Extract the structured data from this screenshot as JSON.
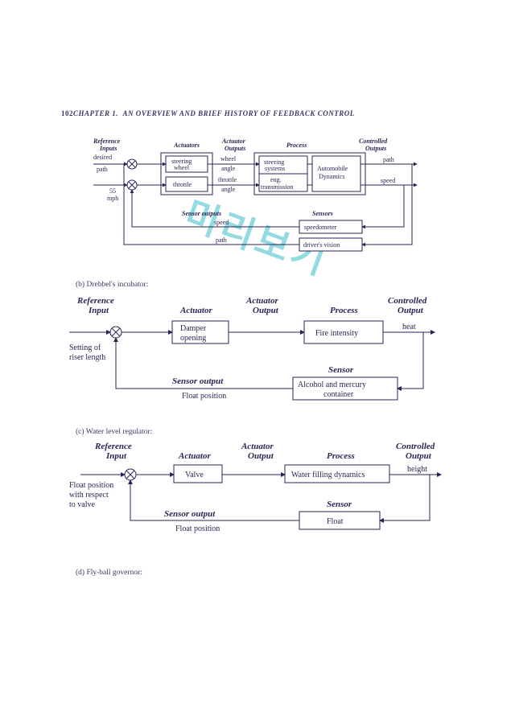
{
  "page": {
    "number": "102",
    "chapter": "CHAPTER 1.",
    "title": "AN OVERVIEW AND BRIEF HISTORY OF FEEDBACK CONTROL"
  },
  "watermark": "미리보기",
  "diagA": {
    "headers": {
      "ref": "Reference\nInputs",
      "act": "Actuators",
      "aout": "Actuator\nOutputs",
      "proc": "Process",
      "cout": "Controlled\nOutputs",
      "sens": "Sensors",
      "sout": "Sensor outputs"
    },
    "labels": {
      "ref1": "desired\npath",
      "ref2": "55\nmph",
      "act1": "steering\nwheel",
      "act2": "throttle",
      "aout1": "wheel\nangle",
      "aout2": "throttle\nangle",
      "proc1a": "steering\nsystems",
      "proc1b": "eng.\ntransmission",
      "proc2": "Automobile\nDynamics",
      "out1": "path",
      "out2": "speed",
      "sens1": "speedometer",
      "sens2": "driver's vision",
      "sout1": "speed",
      "sout2": "path"
    }
  },
  "captionB": "(b)  Drebbel's incubator:",
  "diagB": {
    "headers": {
      "ref": "Reference\nInput",
      "act": "Actuator",
      "aout": "Actuator\nOutput",
      "proc": "Process",
      "cout": "Controlled\nOutput",
      "sens": "Sensor",
      "sout": "Sensor output"
    },
    "labels": {
      "ref": "Setting of\nriser length",
      "act": "Damper\nopening",
      "proc": "Fire intensity",
      "out": "heat",
      "sens": "Alcohol and mercury\ncontainer",
      "sout": "Float position"
    }
  },
  "captionC": "(c)  Water level regulator:",
  "diagC": {
    "headers": {
      "ref": "Reference\nInput",
      "act": "Actuator",
      "aout": "Actuator\nOutput",
      "proc": "Process",
      "cout": "Controlled\nOutput",
      "sens": "Sensor",
      "sout": "Sensor output"
    },
    "labels": {
      "ref": "Float position\nwith respect\nto valve",
      "act": "Valve",
      "proc": "Water filling dynamics",
      "out": "height",
      "sens": "Float",
      "sout": "Float position"
    }
  },
  "captionD": "(d)  Fly-ball governor:"
}
